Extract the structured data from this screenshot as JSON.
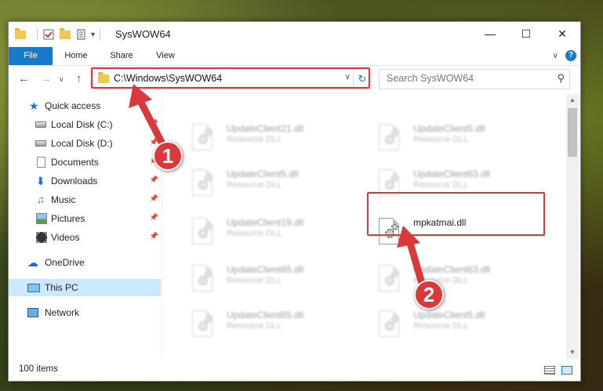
{
  "window": {
    "title": "SysWOW64",
    "controls": {
      "minimize": "—",
      "maximize": "☐",
      "close": "✕"
    }
  },
  "quick_access_toolbar": {
    "dropdown_glyph": "▾"
  },
  "ribbon": {
    "tabs": [
      "File",
      "Home",
      "Share",
      "View"
    ],
    "collapse_glyph": "∨",
    "help_glyph": "?"
  },
  "navigation": {
    "back_glyph": "←",
    "forward_glyph": "→",
    "recent_glyph": "∨",
    "up_glyph": "↑",
    "address": "C:\\Windows\\SysWOW64",
    "address_dropdown_glyph": "∨",
    "refresh_glyph": "↻",
    "search_placeholder": "Search SysWOW64",
    "search_glyph": "⚲"
  },
  "sidebar": {
    "items": [
      {
        "label": "Quick access",
        "icon": "star-icon",
        "pinned": false,
        "selected": false
      },
      {
        "label": "Local Disk (C:)",
        "icon": "disk-icon",
        "pinned": true,
        "selected": false
      },
      {
        "label": "Local Disk (D:)",
        "icon": "disk-icon",
        "pinned": true,
        "selected": false
      },
      {
        "label": "Documents",
        "icon": "documents-icon",
        "pinned": true,
        "selected": false
      },
      {
        "label": "Downloads",
        "icon": "downloads-icon",
        "pinned": true,
        "selected": false
      },
      {
        "label": "Music",
        "icon": "music-icon",
        "pinned": true,
        "selected": false
      },
      {
        "label": "Pictures",
        "icon": "pictures-icon",
        "pinned": true,
        "selected": false
      },
      {
        "label": "Videos",
        "icon": "videos-icon",
        "pinned": true,
        "selected": false
      },
      {
        "label": "OneDrive",
        "icon": "onedrive-icon",
        "pinned": false,
        "selected": false
      },
      {
        "label": "This PC",
        "icon": "this-pc-icon",
        "pinned": false,
        "selected": true
      },
      {
        "label": "Network",
        "icon": "network-icon",
        "pinned": false,
        "selected": false
      }
    ],
    "pin_glyph": "📌"
  },
  "files": [
    {
      "name": "UpdateClient21.dll",
      "type": "Resource DLL",
      "blurred": true
    },
    {
      "name": "UpdateClient5.dll",
      "type": "Resource DLL",
      "blurred": true
    },
    {
      "name": "UpdateClient5.dll",
      "type": "Resource DLL",
      "blurred": true
    },
    {
      "name": "UpdateClient63.dll",
      "type": "Resource DLL",
      "blurred": true
    },
    {
      "name": "UpdateClient19.dll",
      "type": "Resource DLL",
      "blurred": true
    },
    {
      "name": "mpkatmai.dll",
      "type": "",
      "blurred": false
    },
    {
      "name": "UpdateClient65.dll",
      "type": "Resource DLL",
      "blurred": true
    },
    {
      "name": "UpdateClient63.dll",
      "type": "Resource DLL",
      "blurred": true
    },
    {
      "name": "UpdateClient65.dll",
      "type": "Resource DLL",
      "blurred": true
    },
    {
      "name": "UpdateClient5.dll",
      "type": "Resource DLL",
      "blurred": true
    }
  ],
  "status": {
    "item_count": "100 items"
  },
  "scrollbar": {
    "up_glyph": "▲",
    "down_glyph": "▼"
  },
  "annotations": {
    "marker_1": "1",
    "marker_2": "2",
    "highlight_color": "#d9393c"
  },
  "colors": {
    "accent": "#1979ca",
    "selection": "#cce8ff"
  }
}
